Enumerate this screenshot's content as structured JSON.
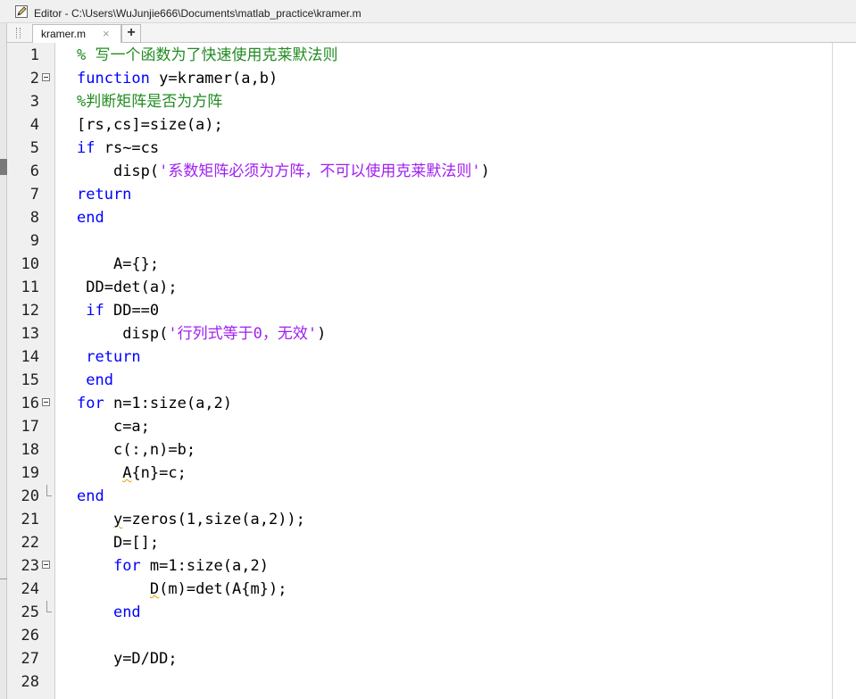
{
  "window": {
    "title": "Editor - C:\\Users\\WuJunjie666\\Documents\\matlab_practice\\kramer.m"
  },
  "tabs": [
    {
      "label": "kramer.m",
      "close": "×"
    }
  ],
  "add_tab_label": "+",
  "editor": {
    "lines": [
      {
        "num": "1",
        "indent": "",
        "fold": "",
        "tokens": [
          {
            "t": "c",
            "v": "% 写一个函数为了快速使用克莱默法则"
          }
        ]
      },
      {
        "num": "2",
        "indent": "",
        "fold": "start",
        "tokens": [
          {
            "t": "k",
            "v": "function"
          },
          {
            "t": "n",
            "v": " y=kramer(a,b)"
          }
        ]
      },
      {
        "num": "3",
        "indent": "",
        "fold": "",
        "tokens": [
          {
            "t": "c",
            "v": "%判断矩阵是否为方阵"
          }
        ]
      },
      {
        "num": "4",
        "indent": "",
        "fold": "",
        "tokens": [
          {
            "t": "n",
            "v": "[rs,cs]=size(a);"
          }
        ]
      },
      {
        "num": "5",
        "indent": "",
        "fold": "",
        "tokens": [
          {
            "t": "k",
            "v": "if"
          },
          {
            "t": "n",
            "v": " rs~=cs"
          }
        ]
      },
      {
        "num": "6",
        "indent": "    ",
        "fold": "",
        "tokens": [
          {
            "t": "n",
            "v": "disp("
          },
          {
            "t": "s",
            "v": "'系数矩阵必须为方阵，不可以使用克莱默法则'"
          },
          {
            "t": "n",
            "v": ")"
          }
        ]
      },
      {
        "num": "7",
        "indent": "",
        "fold": "",
        "tokens": [
          {
            "t": "k",
            "v": "return"
          }
        ]
      },
      {
        "num": "8",
        "indent": "",
        "fold": "",
        "tokens": [
          {
            "t": "k",
            "v": "end"
          }
        ]
      },
      {
        "num": "9",
        "indent": "",
        "fold": "",
        "tokens": []
      },
      {
        "num": "10",
        "indent": "    ",
        "fold": "",
        "tokens": [
          {
            "t": "n",
            "v": "A={};"
          }
        ]
      },
      {
        "num": "11",
        "indent": " ",
        "fold": "",
        "tokens": [
          {
            "t": "n",
            "v": "DD=det(a);"
          }
        ]
      },
      {
        "num": "12",
        "indent": " ",
        "fold": "",
        "tokens": [
          {
            "t": "k",
            "v": "if"
          },
          {
            "t": "n",
            "v": " DD==0"
          }
        ]
      },
      {
        "num": "13",
        "indent": "     ",
        "fold": "",
        "tokens": [
          {
            "t": "n",
            "v": "disp("
          },
          {
            "t": "s",
            "v": "'行列式等于0，无效'"
          },
          {
            "t": "n",
            "v": ")"
          }
        ]
      },
      {
        "num": "14",
        "indent": " ",
        "fold": "",
        "tokens": [
          {
            "t": "k",
            "v": "return"
          }
        ]
      },
      {
        "num": "15",
        "indent": " ",
        "fold": "",
        "tokens": [
          {
            "t": "k",
            "v": "end"
          }
        ]
      },
      {
        "num": "16",
        "indent": "",
        "fold": "start",
        "tokens": [
          {
            "t": "k",
            "v": "for"
          },
          {
            "t": "n",
            "v": " n=1:size(a,2)"
          }
        ]
      },
      {
        "num": "17",
        "indent": "    ",
        "fold": "",
        "tokens": [
          {
            "t": "n",
            "v": "c=a;"
          }
        ]
      },
      {
        "num": "18",
        "indent": "    ",
        "fold": "",
        "tokens": [
          {
            "t": "n",
            "v": "c(:,n)=b;"
          }
        ]
      },
      {
        "num": "19",
        "indent": "     ",
        "fold": "",
        "tokens": [
          {
            "t": "w",
            "v": "A"
          },
          {
            "t": "n",
            "v": "{n}=c;"
          }
        ]
      },
      {
        "num": "20",
        "indent": "",
        "fold": "end",
        "tokens": [
          {
            "t": "k",
            "v": "end"
          }
        ]
      },
      {
        "num": "21",
        "indent": "    ",
        "fold": "",
        "tokens": [
          {
            "t": "w",
            "v": "y"
          },
          {
            "t": "n",
            "v": "=zeros(1,size(a,2));"
          }
        ]
      },
      {
        "num": "22",
        "indent": "    ",
        "fold": "",
        "tokens": [
          {
            "t": "n",
            "v": "D=[];"
          }
        ]
      },
      {
        "num": "23",
        "indent": "    ",
        "fold": "start",
        "tokens": [
          {
            "t": "k",
            "v": "for"
          },
          {
            "t": "n",
            "v": " m=1:size(a,2)"
          }
        ]
      },
      {
        "num": "24",
        "indent": "        ",
        "fold": "",
        "tokens": [
          {
            "t": "w",
            "v": "D"
          },
          {
            "t": "n",
            "v": "(m)=det(A{m});"
          }
        ]
      },
      {
        "num": "25",
        "indent": "    ",
        "fold": "end",
        "tokens": [
          {
            "t": "k",
            "v": "end"
          }
        ]
      },
      {
        "num": "26",
        "indent": "",
        "fold": "",
        "tokens": []
      },
      {
        "num": "27",
        "indent": "    ",
        "fold": "",
        "tokens": [
          {
            "t": "n",
            "v": "y=D/DD;"
          }
        ]
      },
      {
        "num": "28",
        "indent": "",
        "fold": "",
        "tokens": []
      }
    ]
  },
  "colors": {
    "keyword": "#0000ff",
    "comment": "#228b22",
    "string": "#a020f0",
    "text": "#000000"
  }
}
